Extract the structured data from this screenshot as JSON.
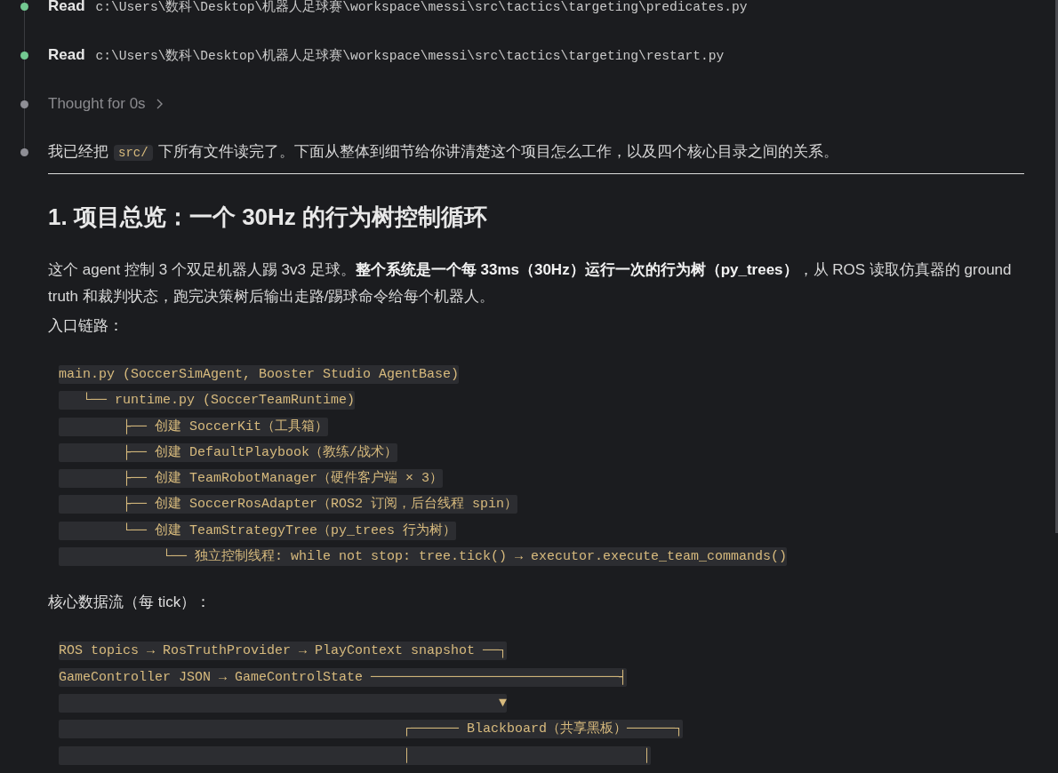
{
  "timeline": [
    {
      "kind": "read",
      "label": "Read",
      "path": "c:\\Users\\数科\\Desktop\\机器人足球赛\\workspace\\messi\\src\\tactics\\targeting\\predicates.py"
    },
    {
      "kind": "read",
      "label": "Read",
      "path": "c:\\Users\\数科\\Desktop\\机器人足球赛\\workspace\\messi\\src\\tactics\\targeting\\restart.py"
    },
    {
      "kind": "thought",
      "label": "Thought for 0s",
      "expanded": false
    },
    {
      "kind": "message",
      "parts": [
        {
          "kind": "text",
          "text": "我已经把"
        },
        {
          "kind": "code",
          "text": "src/"
        },
        {
          "kind": "text",
          "text": "下所有文件读完了。下面从整体到细节给你讲清楚这个项目怎么工作，以及四个核心目录之间的关系。"
        }
      ],
      "blocks": [
        {
          "kind": "rule"
        },
        {
          "kind": "heading",
          "text": "1. 项目总览：一个 30Hz 的行为树控制循环"
        },
        {
          "kind": "paragraph",
          "text": "这个 agent 控制 3 个双足机器人踢 3v3 足球。**整个系统是一个每 33ms（30Hz）运行一次的行为树（py_trees）**，从 ROS 读取仿真器的 ground truth 和裁判状态，跑完决策树后输出走路/踢球命令给每个机器人。"
        },
        {
          "kind": "label",
          "text": "入口链路："
        },
        {
          "kind": "code",
          "lines": [
            "main.py (SoccerSimAgent, Booster Studio AgentBase)",
            "   └── runtime.py (SoccerTeamRuntime)",
            "        ├── 创建 SoccerKit（工具箱）",
            "        ├── 创建 DefaultPlaybook（教练/战术）",
            "        ├── 创建 TeamRobotManager（硬件客户端 × 3）",
            "        ├── 创建 SoccerRosAdapter（ROS2 订阅，后台线程 spin）",
            "        └── 创建 TeamStrategyTree（py_trees 行为树）",
            "             └── 独立控制线程: while not stop: tree.tick() → executor.execute_team_commands()"
          ]
        },
        {
          "kind": "label",
          "text": "核心数据流（每 tick）："
        },
        {
          "kind": "code",
          "lines": [
            "ROS topics → RosTruthProvider → PlayContext snapshot ──┐",
            "GameController JSON → GameControlState ───────────────────────────────┤",
            "                                                       ▼",
            "                                           ┌────── Blackboard（共享黑板）──────┐",
            "                                           │                             │"
          ]
        }
      ]
    }
  ]
}
